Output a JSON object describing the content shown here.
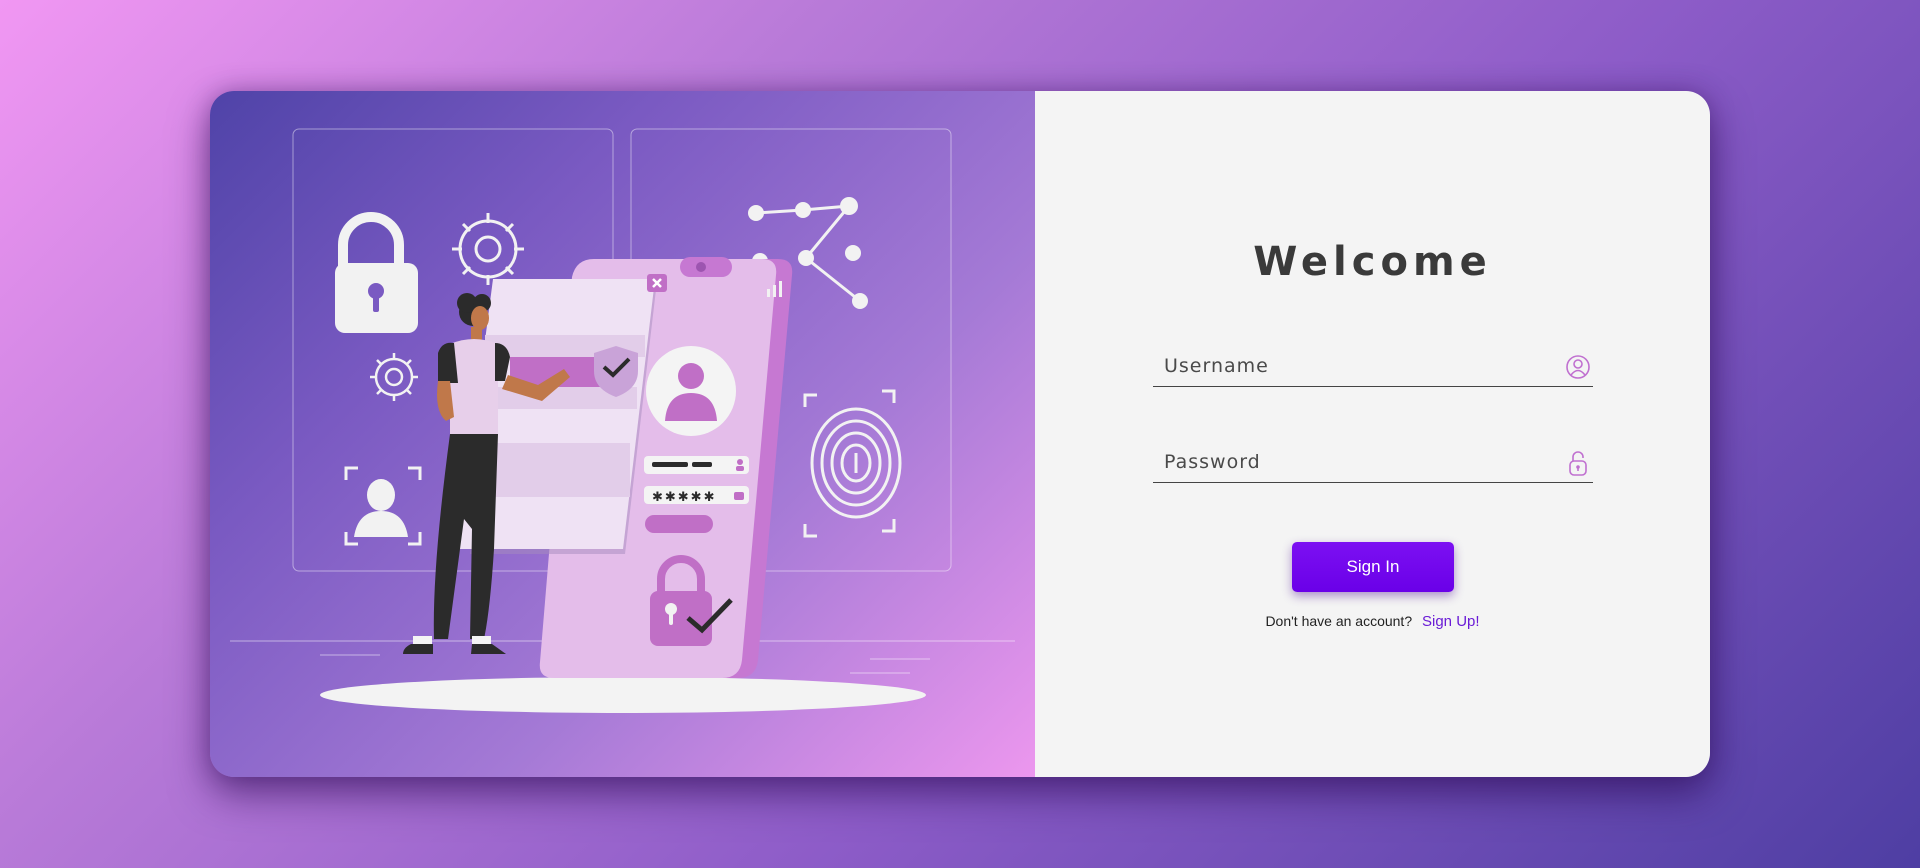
{
  "login": {
    "title": "Welcome",
    "username": {
      "placeholder": "Username",
      "value": "",
      "icon": "user-circle-icon"
    },
    "password": {
      "placeholder": "Password",
      "value": "",
      "icon": "lock-icon"
    },
    "signin_label": "Sign In",
    "signup_prompt": "Don't have an account?",
    "signup_link": "Sign Up!"
  },
  "illustration": {
    "masked_password": "✱✱✱✱✱"
  },
  "colors": {
    "primary": "#6a00e8",
    "accent": "#c070d0",
    "link": "#6a1bd6",
    "panel_bg": "#f4f4f4"
  }
}
